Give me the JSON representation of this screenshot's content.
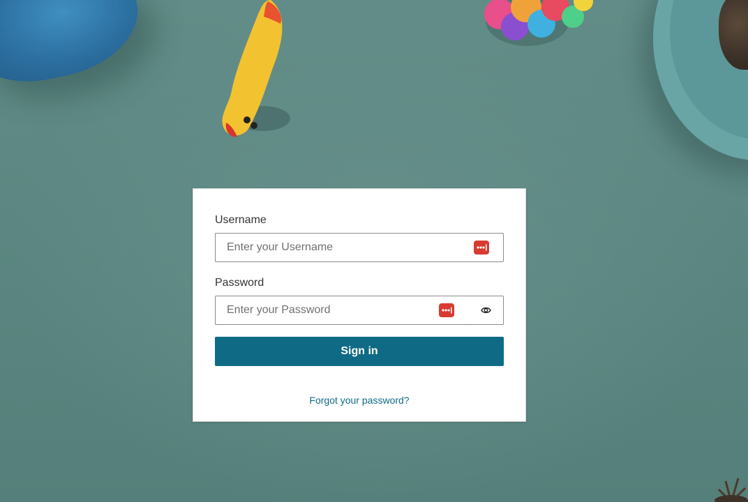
{
  "login": {
    "username_label": "Username",
    "username_placeholder": "Enter your Username",
    "password_label": "Password",
    "password_placeholder": "Enter your Password",
    "signin_label": "Sign in",
    "forgot_label": "Forgot your password?"
  },
  "icons": {
    "password_manager": "password-manager-icon",
    "show_password": "eye-icon"
  },
  "colors": {
    "accent": "#0f6b85",
    "background": "#5b8782",
    "password_manager": "#d93a2f"
  }
}
